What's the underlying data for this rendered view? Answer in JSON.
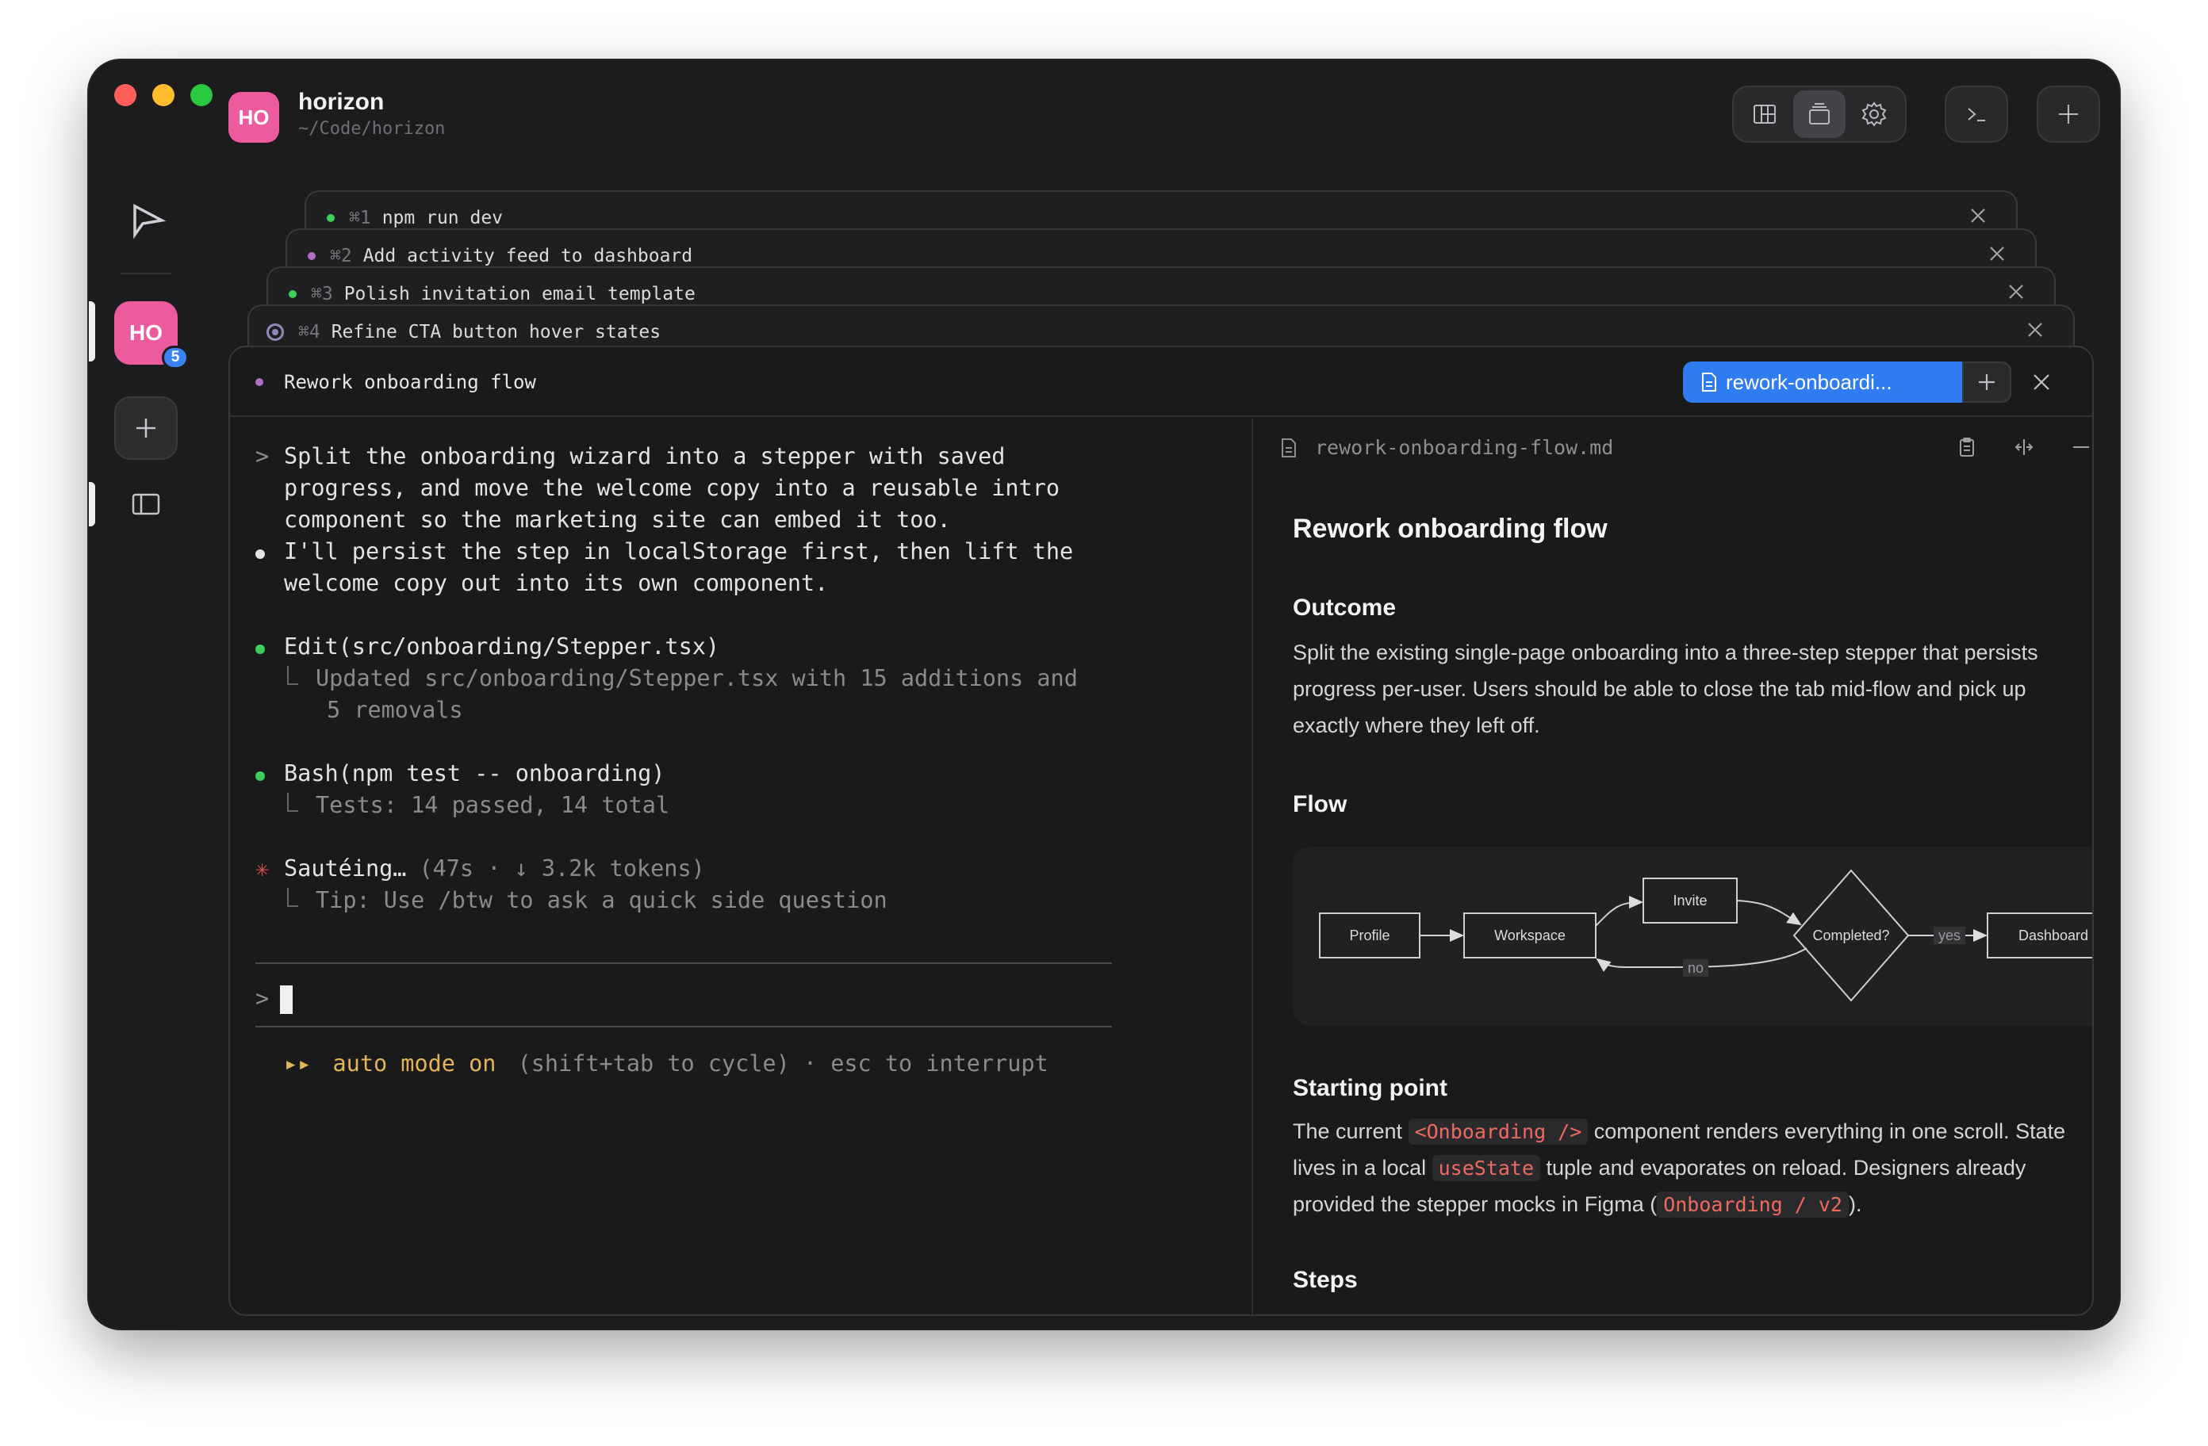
{
  "app": {
    "project_avatar": "HO",
    "project_name": "horizon",
    "project_path": "~/Code/horizon",
    "rail_badge_count": "5"
  },
  "sessions": [
    {
      "shortcut": "⌘1",
      "title": "npm run dev",
      "dot_color": "#3ecf5a"
    },
    {
      "shortcut": "⌘2",
      "title": "Add activity feed to dashboard",
      "dot_color": "#b06fc6"
    },
    {
      "shortcut": "⌘3",
      "title": "Polish invitation email template",
      "dot_color": "#3ecf5a"
    },
    {
      "shortcut": "⌘4",
      "title": "Refine CTA button hover states",
      "dot_color": "#8e8ab8"
    }
  ],
  "active_session": {
    "title": "Rework onboarding flow",
    "doc_tab_label": "rework-onboardi..."
  },
  "terminal": {
    "prompt_symbol": ">",
    "prompt_text": [
      "Split the onboarding wizard into a stepper with saved",
      "progress, and move the welcome copy into a reusable intro",
      "component so the marketing site can embed it too."
    ],
    "reply": [
      "I'll persist the step in localStorage first, then lift the",
      "welcome copy out into its own component."
    ],
    "edit_tool": "Edit(src/onboarding/Stepper.tsx)",
    "edit_result": [
      "Updated src/onboarding/Stepper.tsx with 15 additions and",
      "5 removals"
    ],
    "bash_tool": "Bash(npm test -- onboarding)",
    "bash_result": "Tests: 14 passed, 14 total",
    "thinking_label": "Sautéing…",
    "thinking_meta": "(47s · ↓ 3.2k tokens)",
    "tip": "Tip: Use /btw to ask a quick side question",
    "input_prompt": ">",
    "mode_arrows": "▸▸",
    "mode_label": "auto mode on",
    "mode_hint": "(shift+tab to cycle) · esc to interrupt"
  },
  "document": {
    "filename": "rework-onboarding-flow.md",
    "title": "Rework onboarding flow",
    "outcome_heading": "Outcome",
    "outcome_text": [
      "Split the existing single-page onboarding into a three-step stepper that persists",
      "progress per-user. Users should be able to close the tab mid-flow and pick up",
      "exactly where they left off."
    ],
    "flow_heading": "Flow",
    "flow_nodes": {
      "profile": "Profile",
      "workspace": "Workspace",
      "invite": "Invite",
      "completed": "Completed?",
      "dashboard": "Dashboard",
      "yes": "yes",
      "no": "no"
    },
    "starting_heading": "Starting point",
    "starting_1a": "The current ",
    "starting_code1": "<Onboarding />",
    "starting_1b": " component renders everything in one scroll. State",
    "starting_2a": "lives in a local ",
    "starting_code2": "useState",
    "starting_2b": " tuple and evaporates on reload. Designers already",
    "starting_3a": "provided the stepper mocks in Figma (",
    "starting_code3": "Onboarding / v2",
    "starting_3b": ").",
    "steps_heading": "Steps"
  },
  "icons": {
    "toolbar": [
      "board-icon",
      "stack-icon",
      "gear-icon",
      "terminal-icon",
      "plus-icon"
    ],
    "rail": [
      "logo-icon",
      "plus-icon",
      "sidebar-panel-icon"
    ]
  },
  "colors": {
    "accent_blue": "#2f7cf0",
    "avatar_pink": "#ec5b9e",
    "success_green": "#3ecf5a",
    "code_red": "#ef6a5f",
    "auto_mode_yellow": "#e4b45a"
  }
}
